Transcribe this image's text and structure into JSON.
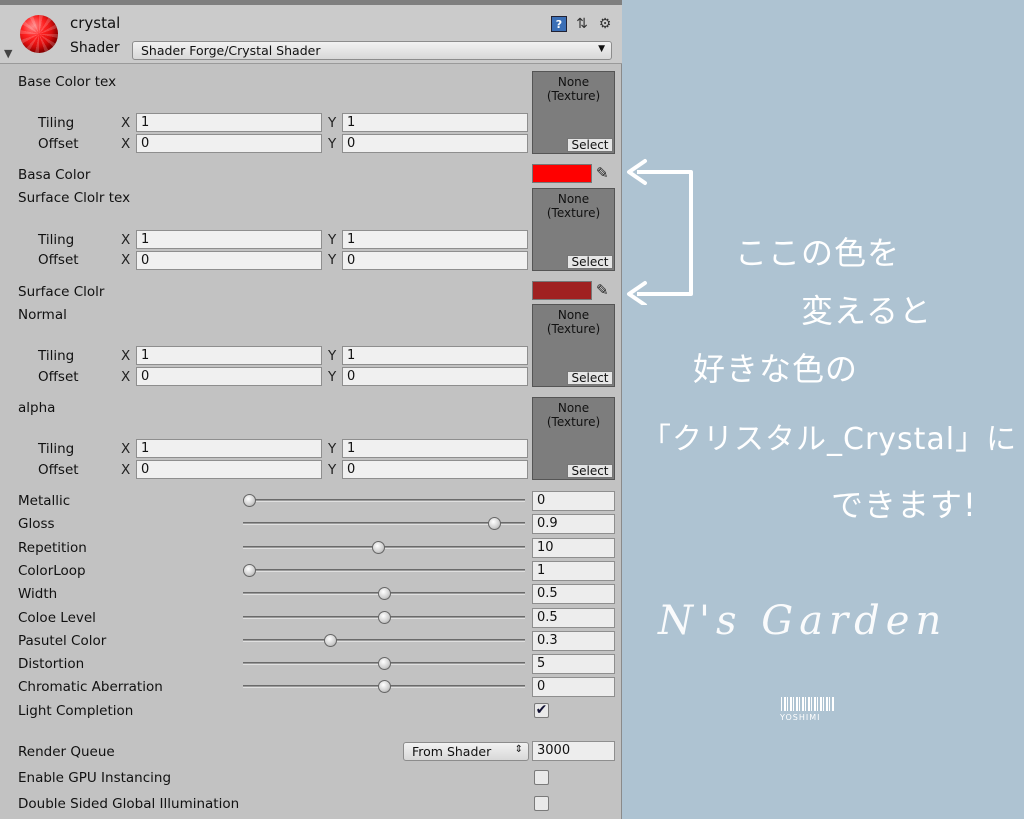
{
  "header": {
    "material_name": "crystal",
    "shader_label": "Shader",
    "shader_value": "Shader Forge/Crystal Shader",
    "icons": [
      "help-icon",
      "preset-icon",
      "gear-icon"
    ]
  },
  "common": {
    "tiling": "Tiling",
    "offset": "Offset",
    "x": "X",
    "y": "Y",
    "tex_none": "None",
    "tex_texture": "(Texture)",
    "tex_select": "Select"
  },
  "textures": [
    {
      "label": "Base Color tex",
      "tiling_x": "1",
      "tiling_y": "1",
      "offset_x": "0",
      "offset_y": "0"
    },
    {
      "label": "Surface Clolr tex",
      "tiling_x": "1",
      "tiling_y": "1",
      "offset_x": "0",
      "offset_y": "0"
    },
    {
      "label": "Normal",
      "tiling_x": "1",
      "tiling_y": "1",
      "offset_x": "0",
      "offset_y": "0"
    },
    {
      "label": "alpha",
      "tiling_x": "1",
      "tiling_y": "1",
      "offset_x": "0",
      "offset_y": "0"
    }
  ],
  "colors": [
    {
      "label": "Basa Color",
      "value": "#ff0000"
    },
    {
      "label": "Surface Clolr",
      "value": "#a02020"
    }
  ],
  "sliders": [
    {
      "label": "Metallic",
      "value": "0",
      "fraction": 0.02
    },
    {
      "label": "Gloss",
      "value": "0.9",
      "fraction": 0.89
    },
    {
      "label": "Repetition",
      "value": "10",
      "fraction": 0.48
    },
    {
      "label": "ColorLoop",
      "value": "1",
      "fraction": 0.02
    },
    {
      "label": "Width",
      "value": "0.5",
      "fraction": 0.5
    },
    {
      "label": "Coloe Level",
      "value": "0.5",
      "fraction": 0.5
    },
    {
      "label": "Pasutel Color",
      "value": "0.3",
      "fraction": 0.31
    },
    {
      "label": "Distortion",
      "value": "5",
      "fraction": 0.5
    },
    {
      "label": "Chromatic Aberration",
      "value": "0",
      "fraction": 0.5
    }
  ],
  "light_completion": {
    "label": "Light Completion",
    "checked": true
  },
  "render_queue": {
    "label": "Render Queue",
    "dropdown": "From Shader",
    "value": "3000"
  },
  "gpu_instancing": {
    "label": "Enable GPU Instancing",
    "checked": false
  },
  "double_sided_gi": {
    "label": "Double Sided Global Illumination",
    "checked": false
  },
  "annotation": {
    "line1": "ここの色を",
    "line2": "変えると",
    "line3": "好きな色の",
    "line4": "「クリスタル_Crystal」に",
    "line5": "できます!",
    "brand": "N's Garden",
    "brand_sub": "YOSHIMI",
    "color": "#ffffff"
  }
}
